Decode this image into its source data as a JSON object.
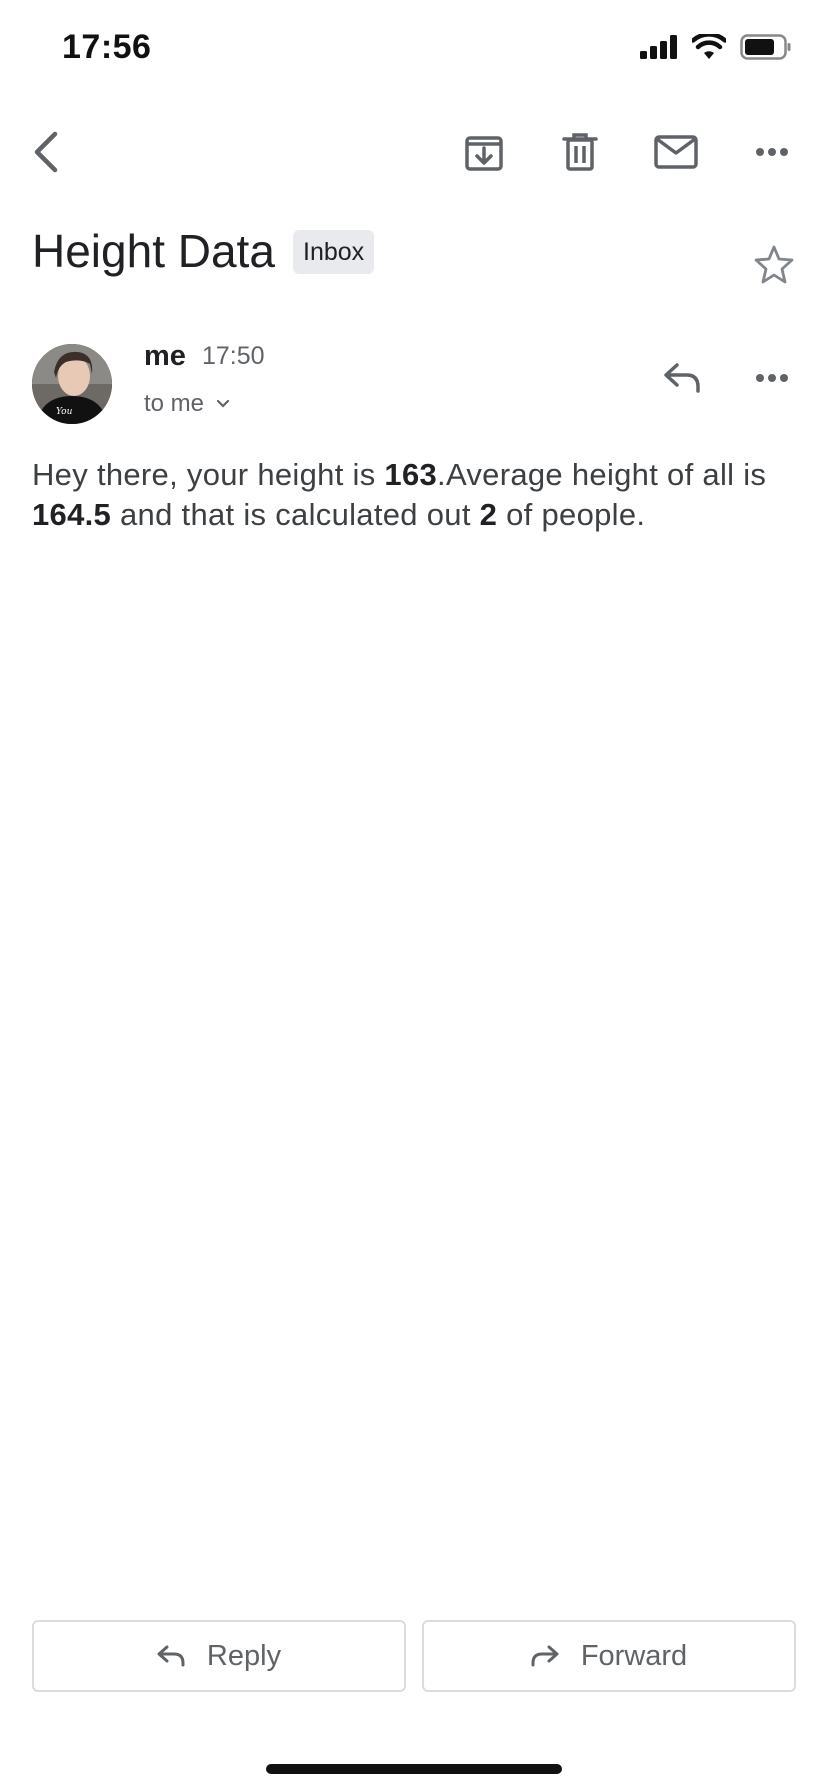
{
  "status": {
    "time": "17:56"
  },
  "email": {
    "subject": "Height Data",
    "label": "Inbox",
    "sender": "me",
    "time": "17:50",
    "recipient": "to me",
    "body": {
      "part1": "Hey there, your height is ",
      "height": "163",
      "part2": ".Average height of all is ",
      "average": "164.5",
      "part3": " and that is calculated out ",
      "count": "2",
      "part4": " of people."
    }
  },
  "actions": {
    "reply": "Reply",
    "forward": "Forward"
  }
}
